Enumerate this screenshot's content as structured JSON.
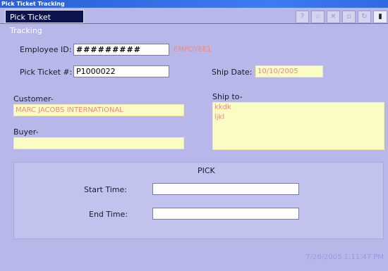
{
  "window": {
    "title": "Pick Ticket Tracking"
  },
  "tab": {
    "label": "Pick Ticket Tracking"
  },
  "toolbar": {
    "buttons": [
      "?",
      "☆",
      "✕",
      "▫",
      "↻",
      "▮"
    ]
  },
  "form": {
    "employee_id_label": "Employee ID:",
    "employee_id_value": "#########",
    "employee_name": "EMPOYEE1",
    "pick_ticket_label": "Pick Ticket #:",
    "pick_ticket_value": "P1000022",
    "ship_date_label": "Ship Date:",
    "ship_date_value": "10/10/2005",
    "customer_label": "Customer-",
    "customer_value": "MARC JACOBS INTERNATIONAL",
    "buyer_label": "Buyer-",
    "buyer_value": "",
    "ship_to_label": "Ship to-",
    "ship_to_line1": "kkdk",
    "ship_to_line2": "ljkl"
  },
  "pick": {
    "title": "PICK",
    "start_label": "Start Time:",
    "start_value": "",
    "end_label": "End Time:",
    "end_value": ""
  },
  "status": {
    "timestamp": "7/26/2005 1:11:47 PM"
  }
}
